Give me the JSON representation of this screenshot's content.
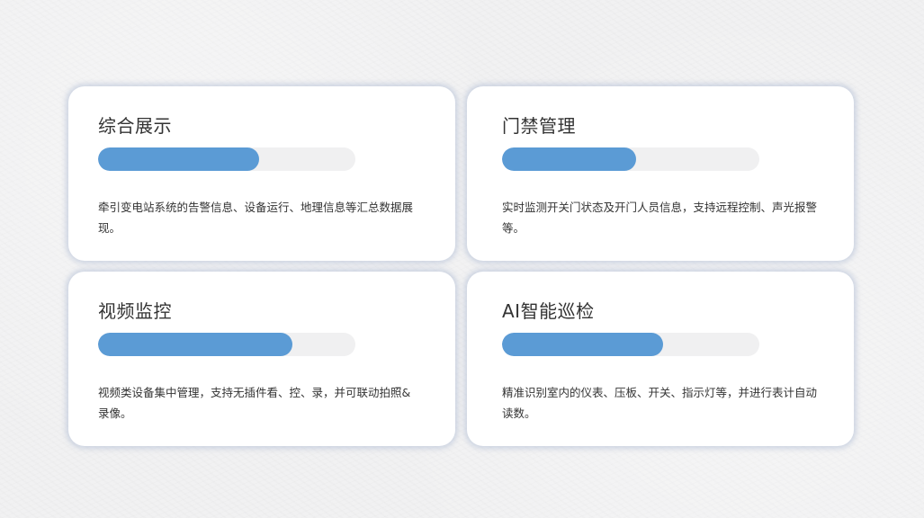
{
  "colors": {
    "background": "#f1f1f2",
    "card": "#ffffff",
    "accent": "#5b9bd5",
    "track": "#f0f0f1",
    "text": "#333333"
  },
  "cards": [
    {
      "title": "综合展示",
      "progress": 0.625,
      "description": "牵引变电站系统的告警信息、设备运行、地理信息等汇总数据展现。"
    },
    {
      "title": "门禁管理",
      "progress": 0.52,
      "description": "实时监测开关门状态及开门人员信息，支持远程控制、声光报警等。"
    },
    {
      "title": "视频监控",
      "progress": 0.755,
      "description": "视频类设备集中管理，支持无插件看、控、录，并可联动拍照&录像。"
    },
    {
      "title": "AI智能巡检",
      "progress": 0.625,
      "description": "精准识别室内的仪表、压板、开关、指示灯等，并进行表计自动读数。"
    }
  ]
}
